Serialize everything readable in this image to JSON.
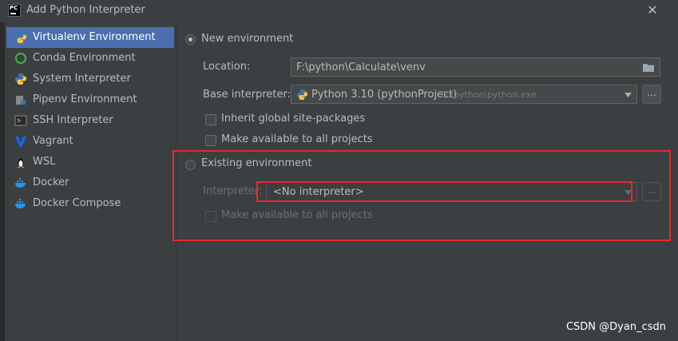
{
  "window": {
    "title": "Add Python Interpreter",
    "close_glyph": "✕",
    "app_icon_text": "PC"
  },
  "sidebar": {
    "items": [
      {
        "label": "Virtualenv Environment",
        "icon": "python-icon",
        "selected": true
      },
      {
        "label": "Conda Environment",
        "icon": "conda-icon"
      },
      {
        "label": "System Interpreter",
        "icon": "python-icon"
      },
      {
        "label": "Pipenv Environment",
        "icon": "pipenv-icon"
      },
      {
        "label": "SSH Interpreter",
        "icon": "terminal-icon"
      },
      {
        "label": "Vagrant",
        "icon": "vagrant-icon"
      },
      {
        "label": "WSL",
        "icon": "linux-icon"
      },
      {
        "label": "Docker",
        "icon": "docker-icon"
      },
      {
        "label": "Docker Compose",
        "icon": "docker-icon"
      }
    ]
  },
  "new_env": {
    "radio_label": "New environment",
    "location_label": "Location:",
    "location_value": "F:\\python\\Calculate\\venv",
    "base_label": "Base interpreter:",
    "base_value": "Python 3.10 (pythonProject)",
    "base_path": "D:\\python\\python.exe",
    "inherit_label": "Inherit global site-packages",
    "make_available_label": "Make available to all projects",
    "browse_label": "..."
  },
  "existing_env": {
    "radio_label": "Existing environment",
    "interpreter_label": "Interpreter:",
    "interpreter_value": "<No interpreter>",
    "make_available_label": "Make available to all projects",
    "browse_label": "..."
  },
  "watermark": "CSDN @Dyan_csdn",
  "colors": {
    "accent": "#4b6eaf",
    "highlight": "#e8282b",
    "background": "#3c3f41"
  }
}
